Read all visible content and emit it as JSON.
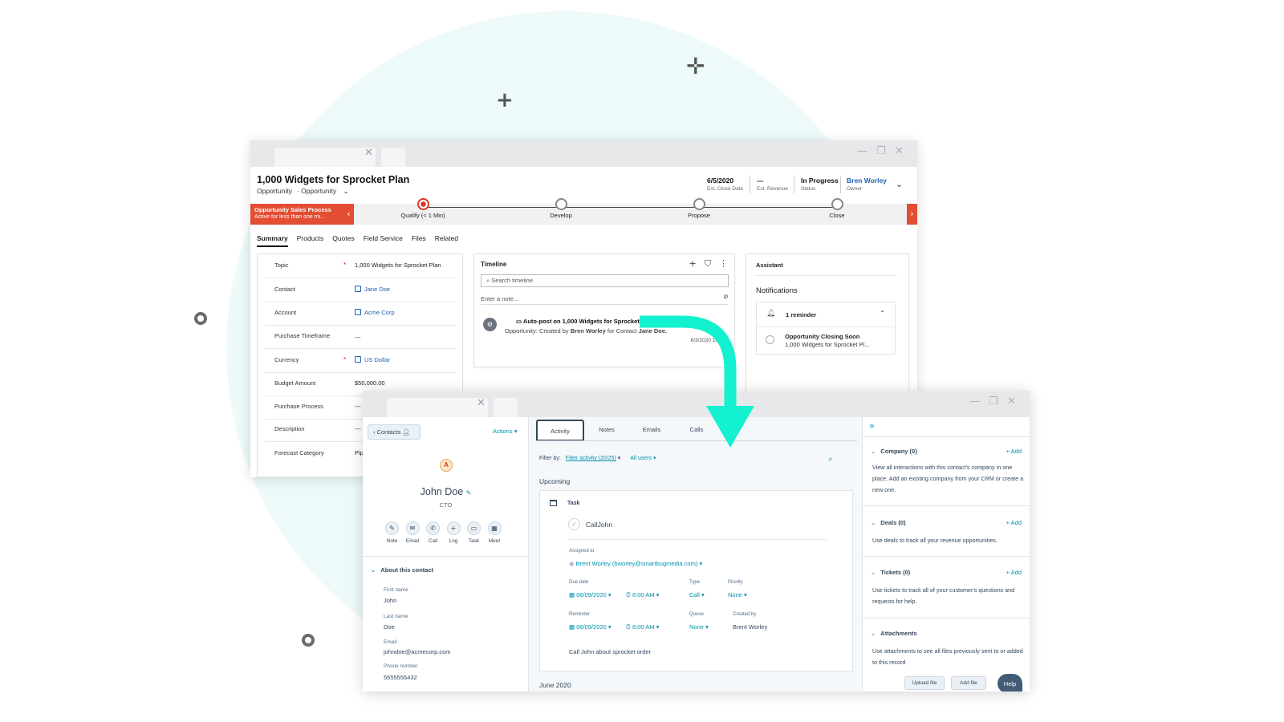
{
  "colors": {
    "accent_red": "#e24d34",
    "hubspot_teal": "#0091ae",
    "arrow_teal": "#14f1d0",
    "link_blue": "#1f5fb5"
  },
  "dynamics": {
    "record_title": "1,000 Widgets for Sprocket Plan",
    "entity": "Opportunity",
    "form_selector": "Opportunity",
    "header_fields": [
      {
        "value": "6/5/2020",
        "label": "Est. Close Date"
      },
      {
        "value": "---",
        "label": "Est. Revenue"
      },
      {
        "value": "In Progress",
        "label": "Status"
      },
      {
        "value": "Bren Worley",
        "label": "Owner"
      }
    ],
    "process": {
      "name": "Opportunity Sales Process",
      "duration": "Active for less than one mi...",
      "stages": [
        "Qualify  (< 1 Min)",
        "Develop",
        "Propose",
        "Close"
      ]
    },
    "tabs": [
      "Summary",
      "Products",
      "Quotes",
      "Field Service",
      "Files",
      "Related"
    ],
    "form": [
      {
        "label": "Topic",
        "required": "*",
        "value": "1,000 Widgets for Sprocket Plan"
      },
      {
        "label": "Contact",
        "required": "",
        "value": "Jane Doe"
      },
      {
        "label": "Account",
        "required": "",
        "value": "Acme Corp"
      },
      {
        "label": "Purchase Timeframe",
        "required": "",
        "value": "---"
      },
      {
        "label": "Currency",
        "required": "*",
        "value": "US Dollar"
      },
      {
        "label": "Budget Amount",
        "required": "",
        "value": "$50,000.00"
      },
      {
        "label": "Purchase Process",
        "required": "",
        "value": "---"
      },
      {
        "label": "Description",
        "required": "",
        "value": "---"
      },
      {
        "label": "Forecast Category",
        "required": "",
        "value": "Pip"
      }
    ],
    "timeline": {
      "title": "Timeline",
      "search_placeholder": "Search timeline",
      "note_placeholder": "Enter a note...",
      "post_title": "Auto-post on 1,000 Widgets for Sprocket",
      "post_meta_prefix": "Opportunity: Created by",
      "post_author": "Bren Worley",
      "post_meta_mid": "for Contact",
      "post_contact": "Jane Doe.",
      "post_date": "6/3/2020 10:53"
    },
    "assistant": {
      "title": "Assistant",
      "notifications": "Notifications",
      "reminder_count": "1 reminder",
      "reminder_title": "Opportunity Closing Soon",
      "reminder_sub": "1,000 Widgets for Sprocket Pl..."
    }
  },
  "hubspot": {
    "back_label": "Contacts",
    "actions_label": "Actions",
    "avatar_letter": "A",
    "contact_name": "John Doe",
    "contact_title": "CTO",
    "quick_actions": [
      "Note",
      "Email",
      "Call",
      "Log",
      "Task",
      "Meet"
    ],
    "about_header": "About this contact",
    "properties": [
      {
        "label": "First name",
        "value": "John"
      },
      {
        "label": "Last name",
        "value": "Doe"
      },
      {
        "label": "Email",
        "value": "johndoe@acmecorp.com"
      },
      {
        "label": "Phone number",
        "value": "5555555432"
      }
    ],
    "tabs": [
      "Activity",
      "Notes",
      "Emails",
      "Calls"
    ],
    "filter_label": "Filter by:",
    "filter_activity": "Filter activity (20/25)",
    "filter_users": "All users",
    "upcoming_label": "Upcoming",
    "task": {
      "type_label": "Task",
      "name": "CallJohn",
      "assigned_label": "Assigned to",
      "assigned_value": "Brent Worley (bworley@smartbugmedia.com)",
      "due_label": "Due date",
      "due_date": "06/09/2020",
      "due_time": "8:00 AM",
      "type_field_label": "Type",
      "type_value": "Call",
      "priority_label": "Priority",
      "priority_value": "None",
      "reminder_label": "Reminder",
      "reminder_date": "06/09/2020",
      "reminder_time": "8:00 AM",
      "queue_label": "Queue",
      "queue_value": "None",
      "created_label": "Created by",
      "created_value": "Brent Worley",
      "description": "Call John about sprocket order"
    },
    "month_label": "June 2020",
    "sidebar": {
      "company_header": "Company (0)",
      "company_text": "View all interactions with this contact's company in one place. Add an existing company from your CRM or create a new one.",
      "deals_header": "Deals (0)",
      "deals_text": "Use deals to track all your revenue opportunities.",
      "tickets_header": "Tickets (0)",
      "tickets_text": "Use tickets to track all of your customer's questions and requests for help.",
      "attachments_header": "Attachments",
      "attachments_text": "Use attachments to see all files previously sent to or added to this record",
      "add_label": "+ Add",
      "upload_label": "Upload file",
      "addfile_label": "Add file",
      "help_label": "Help"
    }
  }
}
